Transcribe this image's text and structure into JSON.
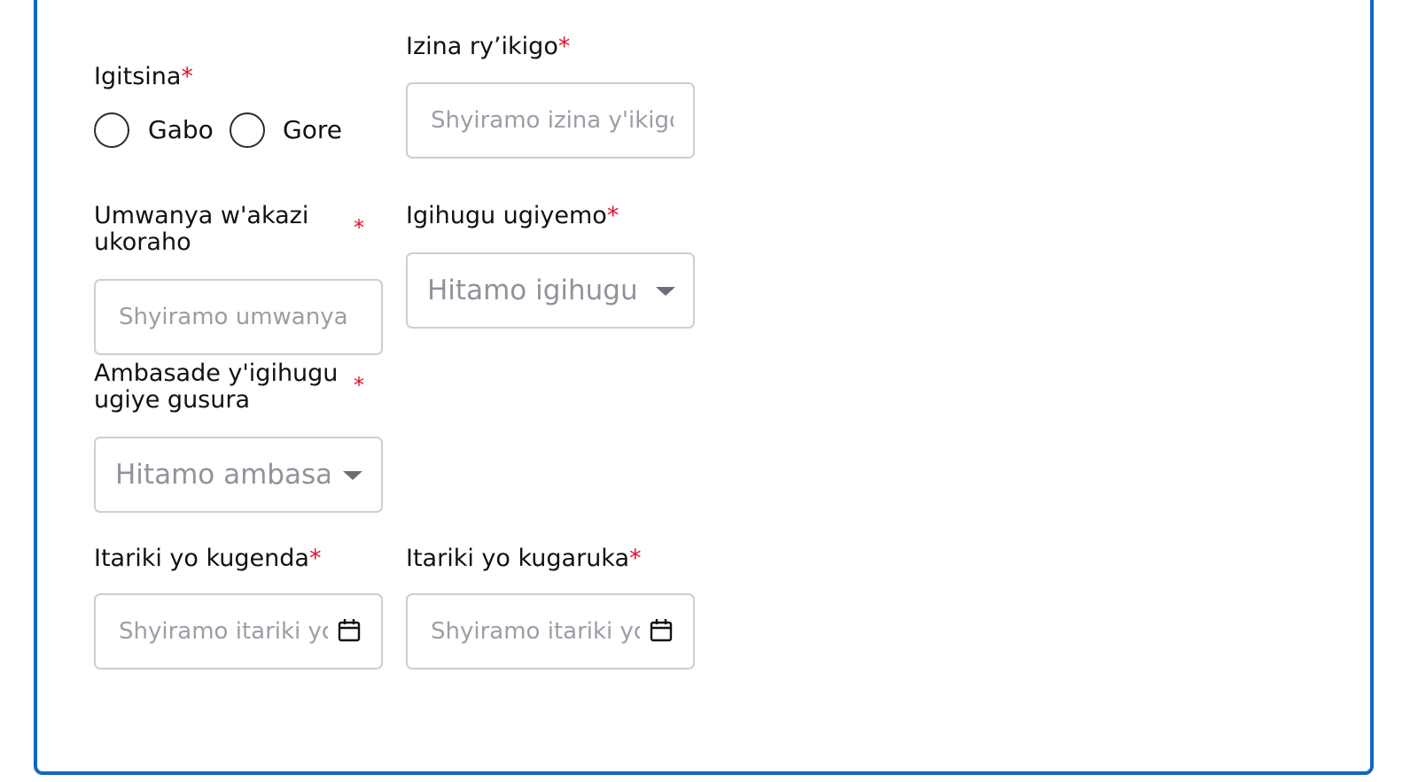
{
  "form": {
    "gender": {
      "label": "Igitsina",
      "required": "*",
      "options": [
        "Gabo",
        "Gore"
      ]
    },
    "company": {
      "label": "Izina ry’ikigo",
      "required": "*",
      "placeholder": "Shyiramo izina y'ikigo"
    },
    "job_position": {
      "label": "Umwanya w'akazi ukoraho",
      "required": "*",
      "placeholder": "Shyiramo umwanya"
    },
    "destination_country": {
      "label": "Igihugu ugiyemo",
      "required": "*",
      "placeholder": "Hitamo igihugu"
    },
    "embassy": {
      "label": "Ambasade y'igihugu ugiye gusura",
      "required": "*",
      "placeholder": "Hitamo ambasade"
    },
    "departure_date": {
      "label": "Itariki yo kugenda",
      "required": "*",
      "placeholder": "Shyiramo itariki yo kugenda"
    },
    "return_date": {
      "label": "Itariki yo kugaruka",
      "required": "*",
      "placeholder": "Shyiramo itariki yo kugaruka"
    }
  },
  "icons": {
    "dropdown": "chevron-down-icon",
    "date": "calendar-icon"
  },
  "colors": {
    "border_accent": "#1565c0",
    "required": "#e0102a",
    "input_border": "#c9cfd8",
    "placeholder": "#9a9ea5"
  }
}
